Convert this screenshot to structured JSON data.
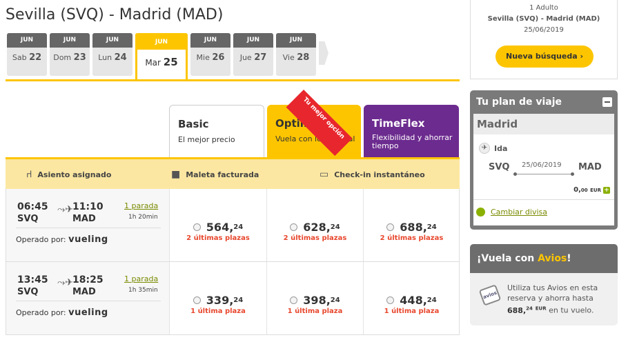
{
  "route_title": "Sevilla (SVQ) - Madrid (MAD)",
  "dates": [
    {
      "month": "JUN",
      "weekday": "Sab",
      "day": "22"
    },
    {
      "month": "JUN",
      "weekday": "Dom",
      "day": "23"
    },
    {
      "month": "JUN",
      "weekday": "Lun",
      "day": "24"
    },
    {
      "month": "JUN",
      "weekday": "Mar",
      "day": "25",
      "selected": true
    },
    {
      "month": "JUN",
      "weekday": "Mie",
      "day": "26"
    },
    {
      "month": "JUN",
      "weekday": "Jue",
      "day": "27"
    },
    {
      "month": "JUN",
      "weekday": "Vie",
      "day": "28"
    }
  ],
  "fares": [
    {
      "name": "Basic",
      "desc": "El mejor precio"
    },
    {
      "name": "Optima",
      "desc": "Vuela con lo esencial"
    },
    {
      "name": "TimeFlex",
      "desc": "Flexibilidad y ahorrar tiempo"
    }
  ],
  "ribbon": "Tu mejor opción",
  "features": [
    "Asiento asignado",
    "Maleta facturada",
    "Check-in instantáneo"
  ],
  "operated_by_label": "Operado por:",
  "airline": "vueling",
  "flights": [
    {
      "dep_time": "06:45",
      "dep_code": "SVQ",
      "arr_time": "11:10",
      "arr_code": "MAD",
      "stops": "1 parada",
      "duration": "1h 20min",
      "prices": [
        {
          "int": "564,",
          "dec": "24",
          "avail": "2 últimas plazas"
        },
        {
          "int": "628,",
          "dec": "24",
          "avail": "2 últimas plazas"
        },
        {
          "int": "688,",
          "dec": "24",
          "avail": "2 últimas plazas"
        }
      ]
    },
    {
      "dep_time": "13:45",
      "dep_code": "SVQ",
      "arr_time": "18:25",
      "arr_code": "MAD",
      "stops": "1 parada",
      "duration": "1h 35min",
      "prices": [
        {
          "int": "339,",
          "dec": "24",
          "avail": "1 última plaza"
        },
        {
          "int": "398,",
          "dec": "24",
          "avail": "1 última plaza"
        },
        {
          "int": "448,",
          "dec": "24",
          "avail": "1 última plaza"
        }
      ]
    }
  ],
  "search": {
    "passengers": "1 Adulto",
    "route": "Sevilla (SVQ) - Madrid (MAD)",
    "date": "25/06/2019",
    "new_search": "Nueva búsqueda"
  },
  "plan": {
    "title": "Tu plan de viaje",
    "city": "Madrid",
    "leg": "Ida",
    "origin": "SVQ",
    "destination": "MAD",
    "date": "25/06/2019",
    "total_int": "0,",
    "total_dec": "00",
    "currency": "EUR",
    "change_currency": "Cambiar divisa"
  },
  "avios": {
    "title_prefix": "¡Vuela con ",
    "title_brand": "Avios",
    "title_suffix": "!",
    "logo": "avios",
    "text_before": "Utiliza tus Avios en esta reserva y ahorra hasta ",
    "amount_int": "688,",
    "amount_dec": "24",
    "amount_cur": "EUR",
    "text_after": " en tu vuelo."
  },
  "colors": {
    "accent": "#fdc500",
    "timeflex": "#6c2b8f",
    "alert": "#e8472d",
    "link": "#7a8a00"
  }
}
